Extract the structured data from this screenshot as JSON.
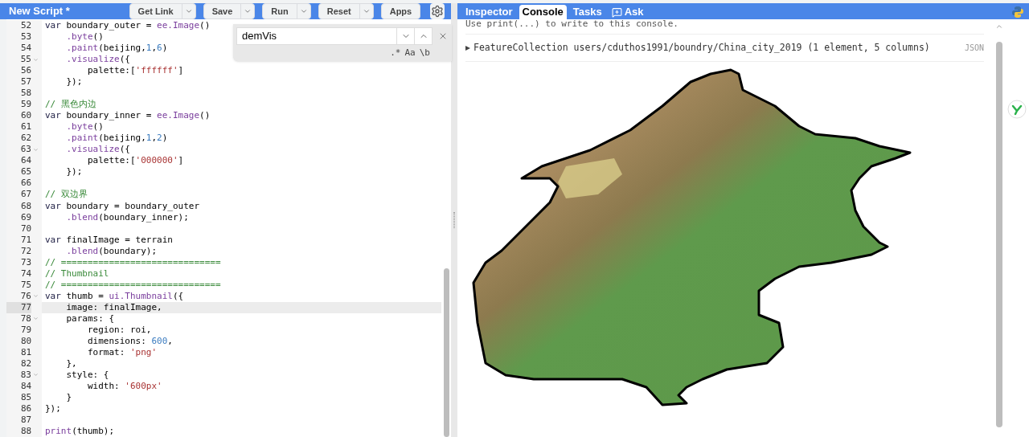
{
  "editor": {
    "title": "New Script *",
    "buttons": [
      {
        "label": "Get Link",
        "dropdown": true
      },
      {
        "label": "Save",
        "dropdown": true
      },
      {
        "label": "Run",
        "dropdown": true
      },
      {
        "label": "Reset",
        "dropdown": true
      },
      {
        "label": "Apps",
        "dropdown": false
      }
    ],
    "search": {
      "value": "demVis",
      "options": [
        ".*",
        "Aa",
        "\\b"
      ]
    },
    "lines": [
      {
        "num": "52",
        "fold": false,
        "active": false,
        "tokens": [
          {
            "kind": "kw",
            "t": "var"
          },
          {
            "kind": "p",
            "t": " boundary_outer = "
          },
          {
            "kind": "fn",
            "t": "ee.Image"
          },
          {
            "kind": "p",
            "t": "()"
          }
        ]
      },
      {
        "num": "53",
        "fold": false,
        "active": false,
        "tokens": [
          {
            "kind": "fn",
            "t": "    .byte"
          },
          {
            "kind": "p",
            "t": "()"
          }
        ]
      },
      {
        "num": "54",
        "fold": false,
        "active": false,
        "tokens": [
          {
            "kind": "fn",
            "t": "    .paint"
          },
          {
            "kind": "p",
            "t": "(beijing,"
          },
          {
            "kind": "num",
            "t": "1"
          },
          {
            "kind": "p",
            "t": ","
          },
          {
            "kind": "num",
            "t": "6"
          },
          {
            "kind": "p",
            "t": ")"
          }
        ]
      },
      {
        "num": "55",
        "fold": true,
        "active": false,
        "tokens": [
          {
            "kind": "fn",
            "t": "    .visualize"
          },
          {
            "kind": "p",
            "t": "({"
          }
        ]
      },
      {
        "num": "56",
        "fold": false,
        "active": false,
        "tokens": [
          {
            "kind": "p",
            "t": "        palette:["
          },
          {
            "kind": "str",
            "t": "'ffffff'"
          },
          {
            "kind": "p",
            "t": "]"
          }
        ]
      },
      {
        "num": "57",
        "fold": false,
        "active": false,
        "tokens": [
          {
            "kind": "p",
            "t": "    });"
          }
        ]
      },
      {
        "num": "58",
        "fold": false,
        "active": false
      },
      {
        "num": "59",
        "fold": false,
        "active": false,
        "tokens": [
          {
            "kind": "cm",
            "t": "// 黑色内边"
          }
        ]
      },
      {
        "num": "60",
        "fold": false,
        "active": false,
        "tokens": [
          {
            "kind": "kw",
            "t": "var"
          },
          {
            "kind": "p",
            "t": " boundary_inner = "
          },
          {
            "kind": "fn",
            "t": "ee.Image"
          },
          {
            "kind": "p",
            "t": "()"
          }
        ]
      },
      {
        "num": "61",
        "fold": false,
        "active": false,
        "tokens": [
          {
            "kind": "fn",
            "t": "    .byte"
          },
          {
            "kind": "p",
            "t": "()"
          }
        ]
      },
      {
        "num": "62",
        "fold": false,
        "active": false,
        "tokens": [
          {
            "kind": "fn",
            "t": "    .paint"
          },
          {
            "kind": "p",
            "t": "(beijing,"
          },
          {
            "kind": "num",
            "t": "1"
          },
          {
            "kind": "p",
            "t": ","
          },
          {
            "kind": "num",
            "t": "2"
          },
          {
            "kind": "p",
            "t": ")"
          }
        ]
      },
      {
        "num": "63",
        "fold": true,
        "active": false,
        "tokens": [
          {
            "kind": "fn",
            "t": "    .visualize"
          },
          {
            "kind": "p",
            "t": "({"
          }
        ]
      },
      {
        "num": "64",
        "fold": false,
        "active": false,
        "tokens": [
          {
            "kind": "p",
            "t": "        palette:["
          },
          {
            "kind": "str",
            "t": "'000000'"
          },
          {
            "kind": "p",
            "t": "]"
          }
        ]
      },
      {
        "num": "65",
        "fold": false,
        "active": false,
        "tokens": [
          {
            "kind": "p",
            "t": "    });"
          }
        ]
      },
      {
        "num": "66",
        "fold": false,
        "active": false
      },
      {
        "num": "67",
        "fold": false,
        "active": false,
        "tokens": [
          {
            "kind": "cm",
            "t": "// 双边界"
          }
        ]
      },
      {
        "num": "68",
        "fold": false,
        "active": false,
        "tokens": [
          {
            "kind": "kw",
            "t": "var"
          },
          {
            "kind": "p",
            "t": " boundary = boundary_outer"
          }
        ]
      },
      {
        "num": "69",
        "fold": false,
        "active": false,
        "tokens": [
          {
            "kind": "fn",
            "t": "    .blend"
          },
          {
            "kind": "p",
            "t": "(boundary_inner);"
          }
        ]
      },
      {
        "num": "70",
        "fold": false,
        "active": false
      },
      {
        "num": "71",
        "fold": false,
        "active": false,
        "tokens": [
          {
            "kind": "kw",
            "t": "var"
          },
          {
            "kind": "p",
            "t": " finalImage = terrain"
          }
        ]
      },
      {
        "num": "72",
        "fold": false,
        "active": false,
        "tokens": [
          {
            "kind": "fn",
            "t": "    .blend"
          },
          {
            "kind": "p",
            "t": "(boundary);"
          }
        ]
      },
      {
        "num": "73",
        "fold": false,
        "active": false,
        "tokens": [
          {
            "kind": "cm",
            "t": "// =============================="
          }
        ]
      },
      {
        "num": "74",
        "fold": false,
        "active": false,
        "tokens": [
          {
            "kind": "cm",
            "t": "// Thumbnail"
          }
        ]
      },
      {
        "num": "75",
        "fold": false,
        "active": false,
        "tokens": [
          {
            "kind": "cm",
            "t": "// =============================="
          }
        ]
      },
      {
        "num": "76",
        "fold": true,
        "active": false,
        "tokens": [
          {
            "kind": "kw",
            "t": "var"
          },
          {
            "kind": "p",
            "t": " thumb = "
          },
          {
            "kind": "fn",
            "t": "ui.Thumbnail"
          },
          {
            "kind": "p",
            "t": "({"
          }
        ]
      },
      {
        "num": "77",
        "fold": false,
        "active": true,
        "tokens": [
          {
            "kind": "p",
            "t": "    image: finalImage,"
          }
        ]
      },
      {
        "num": "78",
        "fold": true,
        "active": false,
        "tokens": [
          {
            "kind": "p",
            "t": "    params: {"
          }
        ]
      },
      {
        "num": "79",
        "fold": false,
        "active": false,
        "tokens": [
          {
            "kind": "p",
            "t": "        region: roi,"
          }
        ]
      },
      {
        "num": "80",
        "fold": false,
        "active": false,
        "tokens": [
          {
            "kind": "p",
            "t": "        dimensions: "
          },
          {
            "kind": "num",
            "t": "600"
          },
          {
            "kind": "p",
            "t": ","
          }
        ]
      },
      {
        "num": "81",
        "fold": false,
        "active": false,
        "tokens": [
          {
            "kind": "p",
            "t": "        format: "
          },
          {
            "kind": "str",
            "t": "'png'"
          }
        ]
      },
      {
        "num": "82",
        "fold": false,
        "active": false,
        "tokens": [
          {
            "kind": "p",
            "t": "    },"
          }
        ]
      },
      {
        "num": "83",
        "fold": true,
        "active": false,
        "tokens": [
          {
            "kind": "p",
            "t": "    style: {"
          }
        ]
      },
      {
        "num": "84",
        "fold": false,
        "active": false,
        "tokens": [
          {
            "kind": "p",
            "t": "        width: "
          },
          {
            "kind": "str",
            "t": "'600px'"
          }
        ]
      },
      {
        "num": "85",
        "fold": false,
        "active": false,
        "tokens": [
          {
            "kind": "p",
            "t": "    }"
          }
        ]
      },
      {
        "num": "86",
        "fold": false,
        "active": false,
        "tokens": [
          {
            "kind": "p",
            "t": "});"
          }
        ]
      },
      {
        "num": "87",
        "fold": false,
        "active": false
      },
      {
        "num": "88",
        "fold": false,
        "active": false,
        "tokens": [
          {
            "kind": "fn",
            "t": "print"
          },
          {
            "kind": "p",
            "t": "(thumb);"
          }
        ]
      }
    ]
  },
  "console": {
    "tabs": [
      {
        "label": "Inspector",
        "selected": false,
        "kind": "plain"
      },
      {
        "label": "Console",
        "selected": true,
        "kind": "plain"
      },
      {
        "label": "Tasks",
        "selected": false,
        "kind": "plain"
      },
      {
        "label": "Ask",
        "selected": false,
        "kind": "ask"
      }
    ],
    "hint": "Use print(...) to write to this console.",
    "entry": {
      "text": "FeatureCollection users/cduthos1991/boundry/China_city_2019 (1 element, 5 columns)",
      "badge": "JSON",
      "expanded": false
    }
  }
}
